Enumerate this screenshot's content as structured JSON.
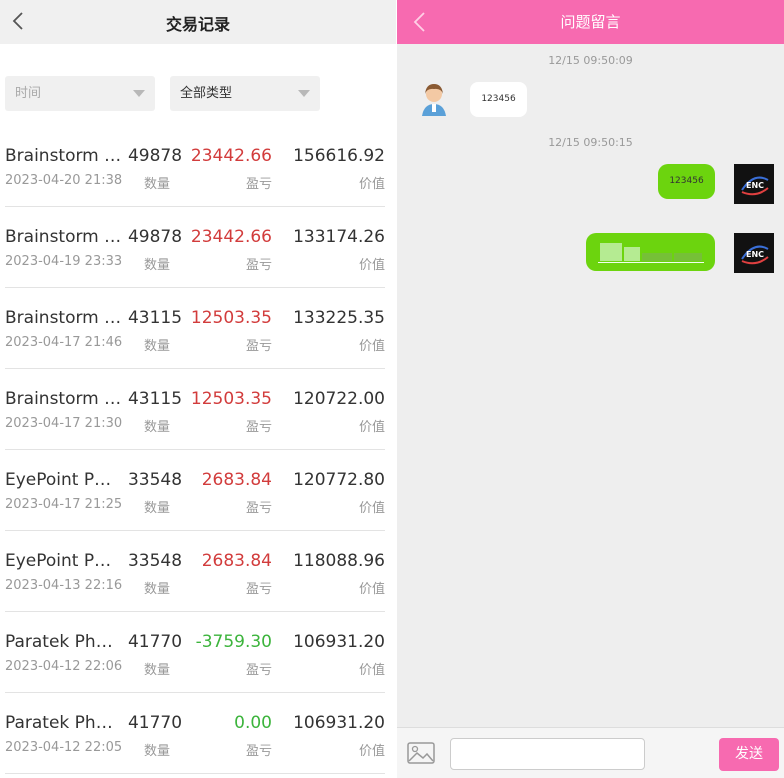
{
  "left": {
    "title": "交易记录",
    "filter_time_placeholder": "时间",
    "filter_type": "全部类型",
    "labels": {
      "qty": "数量",
      "pnl": "盈亏",
      "value": "价值"
    },
    "rows": [
      {
        "name": "Brainstorm …",
        "qty": "49878",
        "pnl": "23442.66",
        "pnl_sign": "pos",
        "value": "156616.92",
        "date": "2023-04-20 21:38"
      },
      {
        "name": "Brainstorm …",
        "qty": "49878",
        "pnl": "23442.66",
        "pnl_sign": "pos",
        "value": "133174.26",
        "date": "2023-04-19 23:33"
      },
      {
        "name": "Brainstorm …",
        "qty": "43115",
        "pnl": "12503.35",
        "pnl_sign": "pos",
        "value": "133225.35",
        "date": "2023-04-17 21:46"
      },
      {
        "name": "Brainstorm …",
        "qty": "43115",
        "pnl": "12503.35",
        "pnl_sign": "pos",
        "value": "120722.00",
        "date": "2023-04-17 21:30"
      },
      {
        "name": "EyePoint P…",
        "qty": "33548",
        "pnl": "2683.84",
        "pnl_sign": "pos",
        "value": "120772.80",
        "date": "2023-04-17 21:25"
      },
      {
        "name": "EyePoint P…",
        "qty": "33548",
        "pnl": "2683.84",
        "pnl_sign": "pos",
        "value": "118088.96",
        "date": "2023-04-13 22:16"
      },
      {
        "name": "Paratek Ph…",
        "qty": "41770",
        "pnl": "-3759.30",
        "pnl_sign": "neg",
        "value": "106931.20",
        "date": "2023-04-12 22:06"
      },
      {
        "name": "Paratek Ph…",
        "qty": "41770",
        "pnl": "0.00",
        "pnl_sign": "zero",
        "value": "106931.20",
        "date": "2023-04-12 22:05"
      }
    ]
  },
  "right": {
    "title": "问题留言",
    "messages": [
      {
        "time": "12/15 09:50:09",
        "direction": "in",
        "text": "123456"
      },
      {
        "time": "12/15 09:50:15",
        "direction": "out",
        "text": "123456"
      },
      {
        "time": "",
        "direction": "out",
        "text": ""
      }
    ],
    "avatar_badge": "ENC",
    "send_label": "发送"
  },
  "colors": {
    "accent_pink": "#f76ab0",
    "bubble_green": "#6cd40e",
    "profit_red": "#d23c3c",
    "loss_green": "#3cb43c"
  }
}
